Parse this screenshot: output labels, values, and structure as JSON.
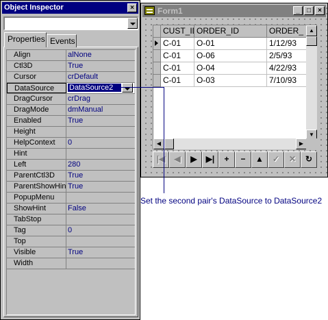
{
  "inspector": {
    "title": "Object Inspector",
    "tabs": [
      {
        "label": "Properties"
      },
      {
        "label": "Events"
      }
    ],
    "properties": [
      {
        "name": "Align",
        "value": "alNone"
      },
      {
        "name": "Ctl3D",
        "value": "True"
      },
      {
        "name": "Cursor",
        "value": "crDefault"
      },
      {
        "name": "DataSource",
        "value": "DataSource2"
      },
      {
        "name": "DragCursor",
        "value": "crDrag"
      },
      {
        "name": "DragMode",
        "value": "dmManual"
      },
      {
        "name": "Enabled",
        "value": "True"
      },
      {
        "name": "Height",
        "value": ""
      },
      {
        "name": "HelpContext",
        "value": "0"
      },
      {
        "name": "Hint",
        "value": ""
      },
      {
        "name": "Left",
        "value": "280"
      },
      {
        "name": "ParentCtl3D",
        "value": "True"
      },
      {
        "name": "ParentShowHint",
        "value": "True"
      },
      {
        "name": "PopupMenu",
        "value": ""
      },
      {
        "name": "ShowHint",
        "value": "False"
      },
      {
        "name": "TabStop",
        "value": ""
      },
      {
        "name": "Tag",
        "value": "0"
      },
      {
        "name": "Top",
        "value": ""
      },
      {
        "name": "Visible",
        "value": "True"
      },
      {
        "name": "Width",
        "value": ""
      }
    ]
  },
  "form1": {
    "title": "Form1",
    "columns": [
      "CUST_ID",
      "ORDER_ID",
      "ORDER_"
    ],
    "rows": [
      [
        "C-01",
        "O-01",
        "1/12/93"
      ],
      [
        "C-01",
        "O-06",
        "2/5/93"
      ],
      [
        "C-01",
        "O-04",
        "4/22/93"
      ],
      [
        "C-01",
        "O-03",
        "7/10/93"
      ]
    ],
    "navigator": [
      "first",
      "prior",
      "next",
      "last",
      "insert",
      "delete",
      "edit",
      "post",
      "cancel",
      "refresh"
    ]
  },
  "callout": {
    "text": "Set the second pair's DataSource to DataSource2"
  }
}
